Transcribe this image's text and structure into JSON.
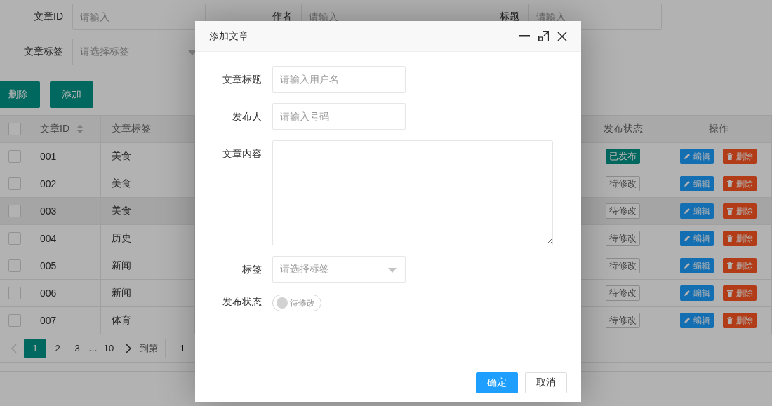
{
  "filters": [
    {
      "label": "文章ID",
      "kind": "input",
      "placeholder": "请输入"
    },
    {
      "label": "作者",
      "kind": "input",
      "placeholder": "请输入"
    },
    {
      "label": "标题",
      "kind": "input",
      "placeholder": "请输入"
    },
    {
      "label": "文章标签",
      "kind": "select",
      "placeholder": "请选择标签"
    }
  ],
  "toolbar": [
    "删除",
    "添加"
  ],
  "table": {
    "all_checked": false,
    "columns": [
      {
        "label": "文章ID",
        "sortable": true
      },
      {
        "label": "文章标签",
        "sortable": false
      },
      {
        "label": "发布状态",
        "sortable": false
      },
      {
        "label": "操作",
        "sortable": false
      }
    ],
    "rows": [
      {
        "checked": false,
        "highlighted": false,
        "id": "001",
        "tag": "美食",
        "status": "已发布",
        "published": true,
        "actions": [
          "编辑",
          "删除"
        ]
      },
      {
        "checked": false,
        "highlighted": false,
        "id": "002",
        "tag": "美食",
        "status": "待修改",
        "published": false,
        "actions": [
          "编辑",
          "删除"
        ]
      },
      {
        "checked": false,
        "highlighted": true,
        "id": "003",
        "tag": "美食",
        "status": "待修改",
        "published": false,
        "actions": [
          "编辑",
          "删除"
        ]
      },
      {
        "checked": false,
        "highlighted": false,
        "id": "004",
        "tag": "历史",
        "status": "待修改",
        "published": false,
        "actions": [
          "编辑",
          "删除"
        ]
      },
      {
        "checked": false,
        "highlighted": false,
        "id": "005",
        "tag": "新闻",
        "status": "待修改",
        "published": false,
        "actions": [
          "编辑",
          "删除"
        ]
      },
      {
        "checked": false,
        "highlighted": false,
        "id": "006",
        "tag": "新闻",
        "status": "待修改",
        "published": false,
        "actions": [
          "编辑",
          "删除"
        ]
      },
      {
        "checked": false,
        "highlighted": false,
        "id": "007",
        "tag": "体育",
        "status": "待修改",
        "published": false,
        "actions": [
          "编辑",
          "删除"
        ]
      }
    ]
  },
  "pagination": {
    "prev_disabled": true,
    "next_disabled": false,
    "pages": [
      {
        "label": "1",
        "kind": "page",
        "selected": true
      },
      {
        "label": "2",
        "kind": "page",
        "selected": false
      },
      {
        "label": "3",
        "kind": "page",
        "selected": false
      },
      {
        "label": "…",
        "kind": "ellipsis",
        "selected": false
      },
      {
        "label": "10",
        "kind": "page",
        "selected": false
      }
    ],
    "goto_label": "到第",
    "goto_value": "1"
  },
  "dialog": {
    "title": "添加文章",
    "fields": [
      {
        "label": "文章标题",
        "kind": "input",
        "placeholder": "请输入用户名"
      },
      {
        "label": "发布人",
        "kind": "input",
        "placeholder": "请输入号码"
      },
      {
        "label": "文章内容",
        "kind": "textarea"
      },
      {
        "label": "标签",
        "kind": "select",
        "placeholder": "请选择标签"
      },
      {
        "label": "发布状态",
        "kind": "switch",
        "on": false,
        "text": "待修改"
      }
    ],
    "buttons": [
      {
        "label": "确定",
        "primary": true
      },
      {
        "label": "取消",
        "primary": false
      }
    ]
  }
}
